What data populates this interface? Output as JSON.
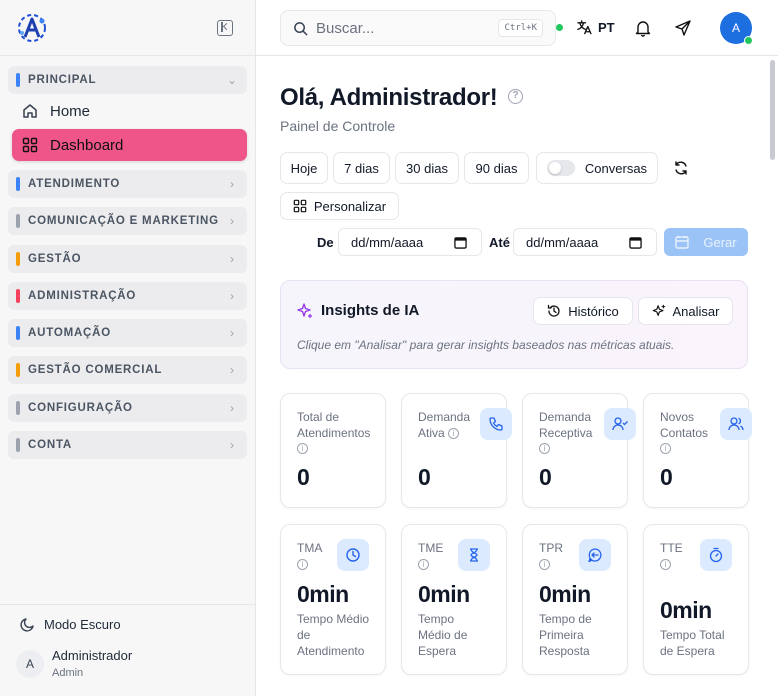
{
  "sidebar": {
    "sections": [
      {
        "label": "PRINCIPAL",
        "color": "#3b82f6",
        "expanded": true
      },
      {
        "label": "ATENDIMENTO",
        "color": "#3b82f6"
      },
      {
        "label": "COMUNICAÇÃO E MARKETING",
        "color": "#9ca3af"
      },
      {
        "label": "GESTÃO",
        "color": "#f59e0b"
      },
      {
        "label": "ADMINISTRAÇÃO",
        "color": "#f43f5e"
      },
      {
        "label": "AUTOMAÇÃO",
        "color": "#3b82f6"
      },
      {
        "label": "GESTÃO COMERCIAL",
        "color": "#f59e0b"
      },
      {
        "label": "CONFIGURAÇÃO",
        "color": "#9ca3af"
      },
      {
        "label": "CONTA",
        "color": "#9ca3af"
      }
    ],
    "items": [
      {
        "label": "Home",
        "icon": "home-icon"
      },
      {
        "label": "Dashboard",
        "icon": "dashboard-icon",
        "active": true
      }
    ],
    "dark_mode_label": "Modo Escuro",
    "user": {
      "initial": "A",
      "name": "Administrador",
      "role": "Admin"
    }
  },
  "topbar": {
    "search_placeholder": "Buscar...",
    "shortcut": "Ctrl+K",
    "language": "PT",
    "avatar_initial": "A"
  },
  "main": {
    "greeting": "Olá, Administrador!",
    "subtitle": "Painel de Controle",
    "filters": [
      "Hoje",
      "7 dias",
      "30 dias",
      "90 dias"
    ],
    "conversas_label": "Conversas",
    "personalizar_label": "Personalizar",
    "de_label": "De",
    "ate_label": "Até",
    "date_placeholder": "dd/mm/aaaa",
    "gerar_label": "Gerar",
    "insights": {
      "title": "Insights de IA",
      "historico_label": "Histórico",
      "analisar_label": "Analisar",
      "hint": "Clique em \"Analisar\" para gerar insights baseados nas métricas atuais."
    },
    "cards_row1": [
      {
        "title": "Total de Atendimentos",
        "value": "0"
      },
      {
        "title": "Demanda Ativa",
        "value": "0",
        "icon": "phone-icon"
      },
      {
        "title": "Demanda Receptiva",
        "value": "0",
        "icon": "user-check-icon"
      },
      {
        "title": "Novos Contatos",
        "value": "0",
        "icon": "users-icon"
      }
    ],
    "cards_row2": [
      {
        "title": "TMA",
        "value": "0min",
        "desc": "Tempo Médio de Atendimento",
        "icon": "clock-icon"
      },
      {
        "title": "TME",
        "value": "0min",
        "desc": "Tempo Médio de Espera",
        "icon": "hourglass-icon"
      },
      {
        "title": "TPR",
        "value": "0min",
        "desc": "Tempo de Primeira Resposta",
        "icon": "message-reply-icon"
      },
      {
        "title": "TTE",
        "value": "0min",
        "desc": "Tempo Total de Espera",
        "icon": "timer-icon"
      }
    ]
  }
}
